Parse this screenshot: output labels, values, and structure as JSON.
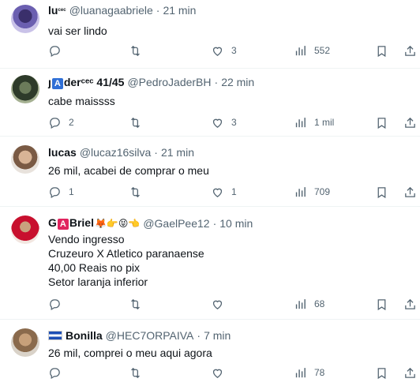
{
  "colors": {
    "text": "#0f1419",
    "muted": "#536471",
    "divider": "#eff3f4"
  },
  "tweets": [
    {
      "name": "lu",
      "name_suffix": "ᶜᵉᶜ",
      "handle": "@luanagaabriele",
      "time": "21 min",
      "lines": [
        "vai ser lindo"
      ],
      "replies": "",
      "retweets": "",
      "likes": "3",
      "views": "552"
    },
    {
      "name_prefix": "ȷ",
      "name_badge": "A",
      "name": "derᶜᵉᶜ 41/45",
      "handle": "@PedroJaderBH",
      "time": "22 min",
      "lines": [
        "cabe maissss"
      ],
      "replies": "2",
      "retweets": "",
      "likes": "3",
      "views": "1 mil"
    },
    {
      "name": "lucas",
      "handle": "@lucaz16silva",
      "time": "21 min",
      "lines": [
        "26 mil, acabei de comprar o meu"
      ],
      "replies": "1",
      "retweets": "",
      "likes": "1",
      "views": "709"
    },
    {
      "name_prefix": "G",
      "name_badge": "A",
      "name": "Briel",
      "name_emojis": "🦊👉😝👈",
      "handle": "@GaelPee12",
      "time": "10 min",
      "lines": [
        "Vendo ingresso",
        "Cruzeuro X Atletico paranaense",
        "40,00 Reais no pix",
        "Setor laranja inferior"
      ],
      "replies": "",
      "retweets": "",
      "likes": "",
      "views": "68"
    },
    {
      "name": "Bonilla",
      "handle": "@HEC7ORPAIVA",
      "time": "7 min",
      "lines": [
        "26 mil, comprei o meu aqui agora"
      ],
      "replies": "",
      "retweets": "",
      "likes": "",
      "views": "78"
    }
  ],
  "separator": "·"
}
